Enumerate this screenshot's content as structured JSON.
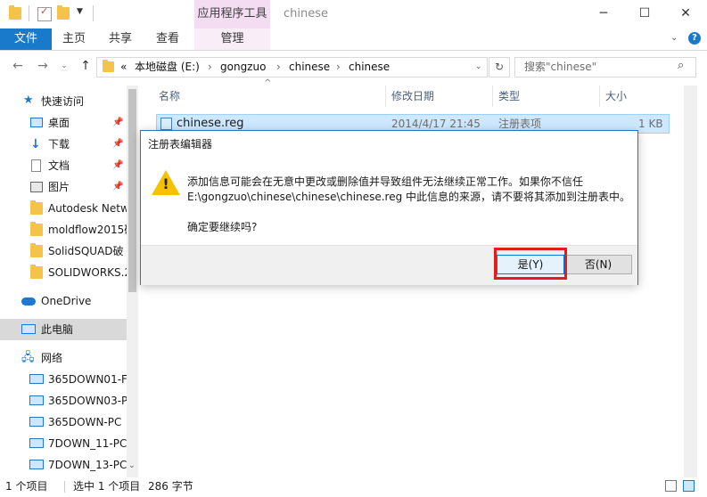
{
  "window": {
    "title": "chinese",
    "context_tab": "应用程序工具",
    "minimize_icon": "minimize-icon",
    "maximize_icon": "maximize-icon",
    "close_icon": "close-icon"
  },
  "ribbon": {
    "tabs": [
      "文件",
      "主页",
      "共享",
      "查看",
      "管理"
    ],
    "accent": "#1979ca"
  },
  "address": {
    "overflow": "«",
    "crumbs": [
      "本地磁盘 (E:)",
      "gongzuo",
      "chinese",
      "chinese"
    ],
    "search_placeholder": "搜索\"chinese\""
  },
  "nav_pane": {
    "quick_access": "快速访问",
    "pinned": [
      {
        "label": "桌面",
        "icon": "desktop-icon"
      },
      {
        "label": "下载",
        "icon": "download-icon"
      },
      {
        "label": "文档",
        "icon": "document-icon"
      },
      {
        "label": "图片",
        "icon": "picture-icon"
      }
    ],
    "folders": [
      "Autodesk Netw",
      "moldflow2015破",
      "SolidSQUAD破",
      "SOLIDWORKS.2"
    ],
    "onedrive": "OneDrive",
    "this_pc": "此电脑",
    "network": "网络",
    "network_items": [
      "365DOWN01-F",
      "365DOWN03-P",
      "365DOWN-PC",
      "7DOWN_11-PC",
      "7DOWN_13-PC"
    ]
  },
  "file_list": {
    "columns": [
      "名称",
      "修改日期",
      "类型",
      "大小"
    ],
    "rows": [
      {
        "name": "chinese.reg",
        "modified": "2014/4/17 21:45",
        "type": "注册表项",
        "size": "1 KB"
      }
    ]
  },
  "status_bar": {
    "count": "1 个项目",
    "selected": "选中 1 个项目",
    "size": "286 字节"
  },
  "dialog": {
    "title": "注册表编辑器",
    "line1": "添加信息可能会在无意中更改或删除值并导致组件无法继续正常工作。如果你不信任",
    "line2": "E:\\gongzuo\\chinese\\chinese\\chinese.reg 中此信息的来源，请不要将其添加到注册表中。",
    "question": "确定要继续吗?",
    "yes": "是(Y)",
    "no": "否(N)",
    "highlight_color": "#e21b1b"
  }
}
